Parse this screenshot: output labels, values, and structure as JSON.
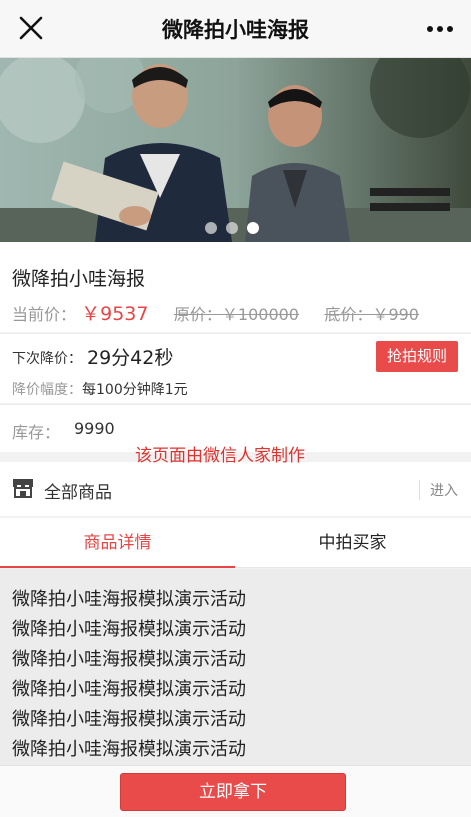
{
  "header": {
    "title": "微降拍小哇海报",
    "close_icon": "close-icon",
    "more_icon": "more-dots-icon"
  },
  "banner": {
    "slide_count": 3,
    "active_index": 2
  },
  "product": {
    "name": "微降拍小哇海报",
    "current_price_label": "当前价：",
    "current_price": "￥9537",
    "original_price_label": "原价：￥100000",
    "floor_price_label": "底价：￥990"
  },
  "countdown": {
    "label": "下次降价：",
    "time": "29分42秒",
    "rule_button": "抢拍规则",
    "decrease_label": "降价幅度：",
    "decrease_value": "每100分钟降1元"
  },
  "stock": {
    "label": "库存：",
    "value": "9990"
  },
  "watermark": "该页面由微信人家制作",
  "all_goods": {
    "label": "全部商品",
    "enter": "进入"
  },
  "tabs": [
    {
      "label": "商品详情",
      "active": true
    },
    {
      "label": "中拍买家",
      "active": false
    }
  ],
  "detail_lines": [
    "微降拍小哇海报模拟演示活动",
    "微降拍小哇海报模拟演示活动",
    "微降拍小哇海报模拟演示活动",
    "微降拍小哇海报模拟演示活动",
    "微降拍小哇海报模拟演示活动",
    "微降拍小哇海报模拟演示活动"
  ],
  "footer": {
    "buy_button": "立即拿下"
  },
  "colors": {
    "accent": "#e94a4a",
    "price": "#e84545",
    "muted": "#999999"
  }
}
